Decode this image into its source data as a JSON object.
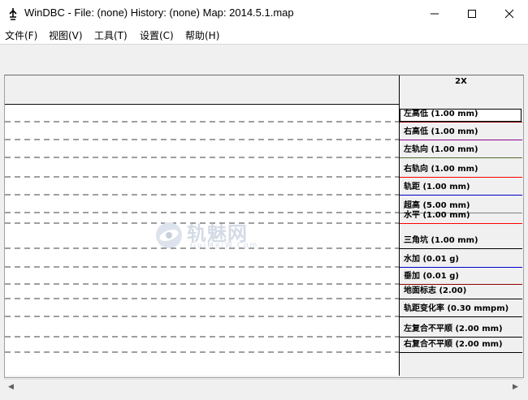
{
  "window": {
    "title": "WinDBC -  File: (none)   History: (none)  Map: 2014.5.1.map"
  },
  "menu": [
    {
      "label": "文件(F)"
    },
    {
      "label": "视图(V)"
    },
    {
      "label": "工具(T)"
    },
    {
      "label": "设置(C)"
    },
    {
      "label": "帮助(H)"
    }
  ],
  "chart": {
    "scale_label": "2X"
  },
  "channels": [
    {
      "label": "左高低 (1.00 mm)",
      "color": "#8b0000"
    },
    {
      "label": "右高低 (1.00 mm)",
      "color": "#8b008b"
    },
    {
      "label": "左轨向 (1.00 mm)",
      "color": "#556b2f"
    },
    {
      "label": "右轨向 (1.00 mm)",
      "color": "#ff0000"
    },
    {
      "label": "轨距 (1.00 mm)",
      "color": "#0000cd"
    },
    {
      "label": "超高 (5.00 mm)",
      "color": "#808080"
    },
    {
      "label": "水平 (1.00 mm)",
      "color": "#ff0000"
    },
    {
      "label": "三角坑 (1.00 mm)",
      "color": "#000000"
    },
    {
      "label": "水加 (0.01 g)",
      "color": "#0000cd"
    },
    {
      "label": "垂加 (0.01 g)",
      "color": "#8b0000"
    },
    {
      "label": "地面标志 (2.00)",
      "color": "#000000"
    },
    {
      "label": "轨距变化率 (0.30 mmpm)",
      "color": "#000000"
    },
    {
      "label": "左复合不平顺 (2.00 mm)",
      "color": "#000000"
    },
    {
      "label": "右复合不平顺 (2.00 mm)",
      "color": "#000000"
    }
  ],
  "watermark": {
    "text": "轨魅网",
    "sub": "GuiMeiW.Com"
  }
}
